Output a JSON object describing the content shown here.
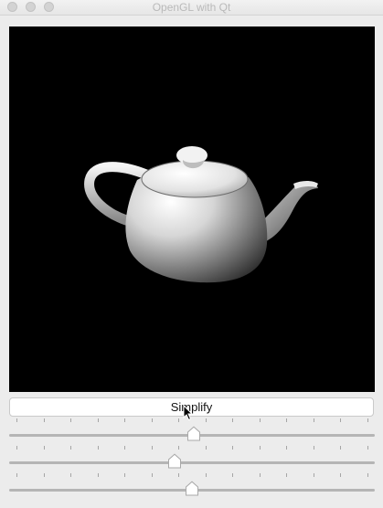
{
  "window": {
    "title": "OpenGL with Qt"
  },
  "viewport": {
    "scene": "teapot",
    "background": "#000000"
  },
  "controls": {
    "simplify_label": "Simplify",
    "sliders": [
      {
        "value_fraction": 0.505,
        "tick_count": 14
      },
      {
        "value_fraction": 0.45,
        "tick_count": 14
      },
      {
        "value_fraction": 0.5,
        "tick_count": 14
      }
    ]
  }
}
